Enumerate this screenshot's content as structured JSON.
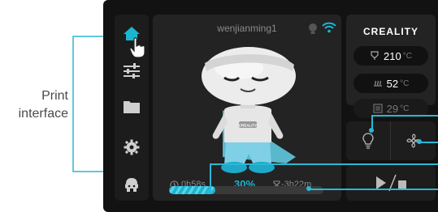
{
  "callout": {
    "label_line1": "Print",
    "label_line2": "interface"
  },
  "sidebar": {
    "items": [
      {
        "icon": "home-icon",
        "active": true
      },
      {
        "icon": "sliders-icon"
      },
      {
        "icon": "folder-icon"
      },
      {
        "icon": "gear-icon"
      },
      {
        "icon": "robot-icon"
      }
    ]
  },
  "main": {
    "device_name": "wenjianming1",
    "status_icons": [
      "light-icon",
      "wifi-icon"
    ],
    "model_badge": "CREALITY",
    "elapsed_time": "0h58s",
    "progress_label": "30%",
    "progress_value": 0.3,
    "remaining_time": "-3h22m"
  },
  "right": {
    "brand": "CREALITY",
    "nozzle_temp": "210",
    "bed_temp": "52",
    "chamber_temp": "29",
    "unit": "°C"
  },
  "colors": {
    "accent": "#19b6d2",
    "device_bg": "#121212",
    "panel_bg": "#232323"
  }
}
